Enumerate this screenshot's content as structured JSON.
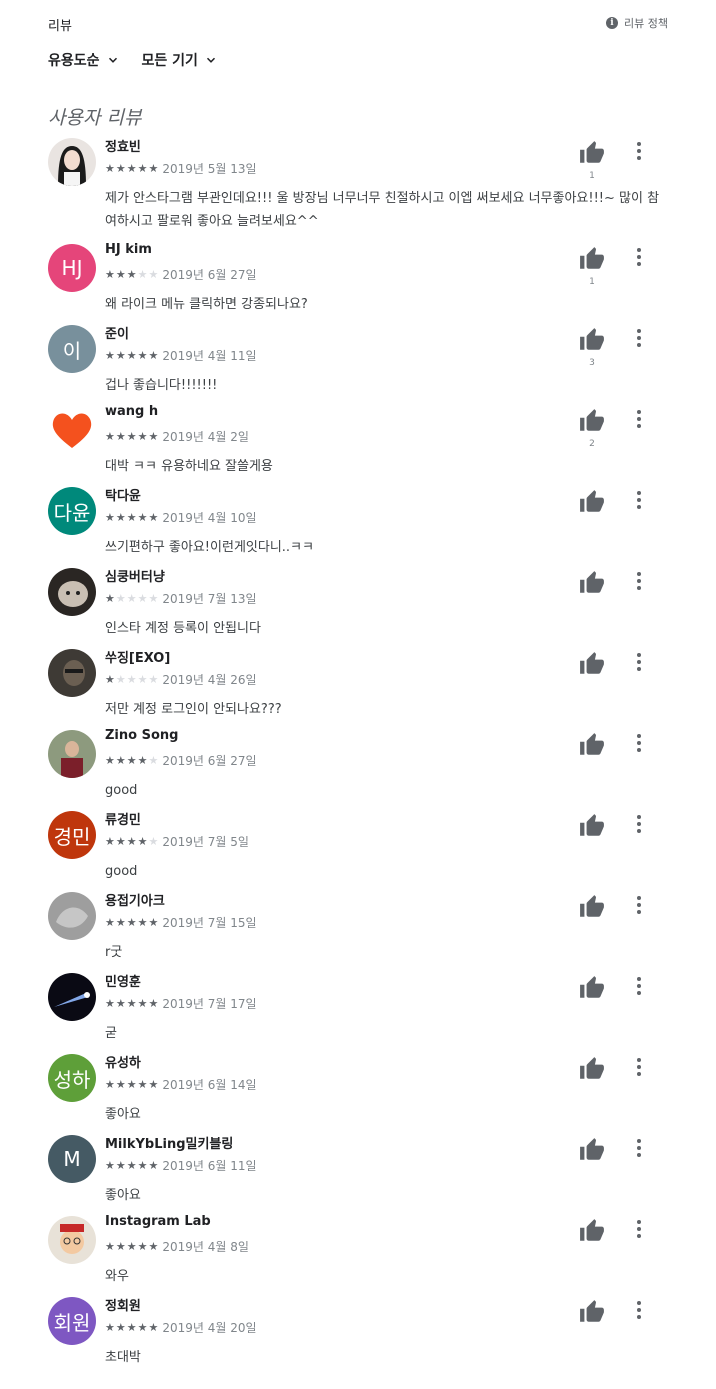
{
  "header": {
    "title": "리뷰",
    "policy_label": "리뷰 정책",
    "policy_icon": "info-icon"
  },
  "filters": {
    "sort_label": "유용도순",
    "device_label": "모든 기기"
  },
  "section_title": "사용자 리뷰",
  "reviews": [
    {
      "name": "정효빈",
      "rating": 5,
      "date": "2019년 5월 13일",
      "text": "제가 안스타그램 부관인데요!!! 울 방장님 너무너무 친절하시고 이엡 써보세요 너무좋아요!!!~ 많이 참여하시고 팔로워 좋아요 늘려보세요^^",
      "likes": "1",
      "avatar": {
        "type": "photo",
        "label": "girl-photo-avatar",
        "color": "#d8d2cf"
      }
    },
    {
      "name": "HJ kim",
      "rating": 3,
      "date": "2019년 6월 27일",
      "text": "왜 라이크 메뉴 클릭하면 강종되나요?",
      "likes": "1",
      "avatar": {
        "type": "initials",
        "initials": "HJ",
        "color": "#e5457a"
      }
    },
    {
      "name": "준이",
      "rating": 5,
      "date": "2019년 4월 11일",
      "text": "겁나 좋습니다!!!!!!!",
      "likes": "3",
      "avatar": {
        "type": "initials",
        "initials": "이",
        "color": "#78909c"
      }
    },
    {
      "name": "wang h",
      "rating": 5,
      "date": "2019년 4월 2일",
      "text": "대박 ㅋㅋ 유용하네요 잘쓸게용",
      "likes": "2",
      "avatar": {
        "type": "heart",
        "label": "heart-avatar",
        "color": "#f4511e"
      }
    },
    {
      "name": "탁다윤",
      "rating": 5,
      "date": "2019년 4월 10일",
      "text": "쓰기편하구 좋아요!이런게잇다니..ㅋㅋ",
      "likes": "",
      "avatar": {
        "type": "initials",
        "initials": "다윤",
        "color": "#00897b"
      }
    },
    {
      "name": "심쿵버터냥",
      "rating": 1,
      "date": "2019년 7월 13일",
      "text": "인스타 계정 등록이 안됩니다",
      "likes": "",
      "avatar": {
        "type": "photo",
        "label": "cat-photo-avatar",
        "color": "#c9bfb3"
      }
    },
    {
      "name": "쑤징[EXO]",
      "rating": 1,
      "date": "2019년 4월 26일",
      "text": "저만 계정 로그인이 안되나요???",
      "likes": "",
      "avatar": {
        "type": "photo",
        "label": "person-photo-avatar",
        "color": "#3e3a35"
      }
    },
    {
      "name": "Zino Song",
      "rating": 4,
      "date": "2019년 6월 27일",
      "text": "good",
      "likes": "",
      "avatar": {
        "type": "photo",
        "label": "man-photo-avatar",
        "color": "#8d9a7e"
      }
    },
    {
      "name": "류경민",
      "rating": 4,
      "date": "2019년 7월 5일",
      "text": "good",
      "likes": "",
      "avatar": {
        "type": "initials",
        "initials": "경민",
        "color": "#bf360c"
      }
    },
    {
      "name": "용접기아크",
      "rating": 5,
      "date": "2019년 7월 15일",
      "text": "r굿",
      "likes": "",
      "avatar": {
        "type": "photo",
        "label": "sketch-photo-avatar",
        "color": "#9e9e9e"
      }
    },
    {
      "name": "민영훈",
      "rating": 5,
      "date": "2019년 7월 17일",
      "text": "굳",
      "likes": "",
      "avatar": {
        "type": "photo",
        "label": "comet-photo-avatar",
        "color": "#0a0a14"
      }
    },
    {
      "name": "유성하",
      "rating": 5,
      "date": "2019년 6월 14일",
      "text": "좋아요",
      "likes": "",
      "avatar": {
        "type": "initials",
        "initials": "성하",
        "color": "#5e9f39"
      }
    },
    {
      "name": "MilkYbLing밀키블링",
      "rating": 5,
      "date": "2019년 6월 11일",
      "text": "좋아요",
      "likes": "",
      "avatar": {
        "type": "initials",
        "initials": "M",
        "color": "#455a64"
      }
    },
    {
      "name": "Instagram Lab",
      "rating": 5,
      "date": "2019년 4월 8일",
      "text": "와우",
      "likes": "",
      "avatar": {
        "type": "photo",
        "label": "cartoon-photo-avatar",
        "color": "#e8e2d8"
      }
    },
    {
      "name": "정회원",
      "rating": 5,
      "date": "2019년 4월 20일",
      "text": "초대박",
      "likes": "",
      "avatar": {
        "type": "initials",
        "initials": "회원",
        "color": "#7e57c2"
      }
    }
  ],
  "icons": {
    "like": "thumbs-up-icon",
    "more": "more-vertical-icon",
    "star": "star-icon",
    "chevron": "chevron-down-icon"
  }
}
